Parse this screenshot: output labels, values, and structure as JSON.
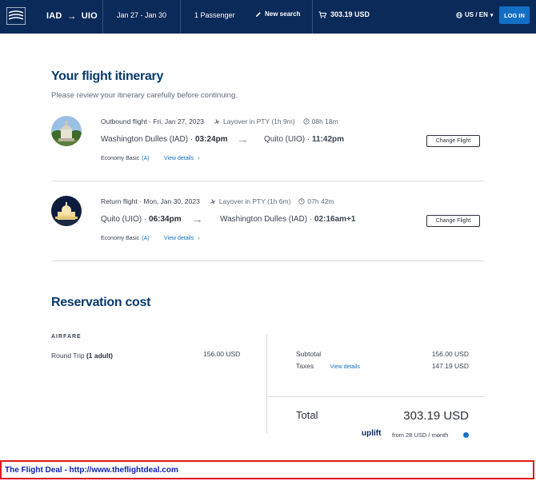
{
  "header": {
    "origin": "IAD",
    "destination": "UIO",
    "dates": "Jan 27 - Jan 30",
    "passengers": "1 Passenger",
    "new_search": "New search",
    "cart_total": "303.19 USD",
    "language": "US / EN",
    "login": "LOG IN",
    "colors": {
      "bar": "#0a2a5a",
      "login_button": "#1170c4"
    }
  },
  "main": {
    "title": "Your flight itinerary",
    "subtitle": "Please review your itinerary carefully before continuing.",
    "flights": [
      {
        "label": "Outbound flight · Fri, Jan 27, 2023",
        "layover": "Layover in PTY (1h 9m)",
        "duration": "08h 18m",
        "from": "Washington Dulles (IAD) · ",
        "from_time": "03:24pm",
        "to": "Quito (UIO) · ",
        "to_time": "11:42pm",
        "fare_class": "Economy Basic",
        "fare_code": "(A)",
        "view_details": "View details",
        "change": "Change Flight"
      },
      {
        "label": "Return flight · Mon, Jan 30, 2023",
        "layover": "Layover in PTY (1h 6m)",
        "duration": "07h 42m",
        "from": "Quito (UIO) · ",
        "from_time": "06:34pm",
        "to": "Washington Dulles (IAD) · ",
        "to_time": "02:16am+1",
        "fare_class": "Economy Basic",
        "fare_code": "(A)",
        "view_details": "View details",
        "change": "Change Flight"
      }
    ]
  },
  "cost": {
    "title": "Reservation cost",
    "airfare_heading": "AIRFARE",
    "trip_type": "Round Trip ",
    "adults": "(1 adult)",
    "airfare_amount": "156.00 USD",
    "subtotal_label": "Subtotal",
    "subtotal": "156.00 USD",
    "taxes_label": "Taxes",
    "taxes_link": "View details",
    "taxes": "147.19 USD",
    "total_label": "Total",
    "total": "303.19 USD",
    "uplift_brand": "uplift",
    "uplift_text": "from 28 USD  / month"
  },
  "banner": {
    "text": "The Flight Deal - http://www.theflightdeal.com"
  }
}
